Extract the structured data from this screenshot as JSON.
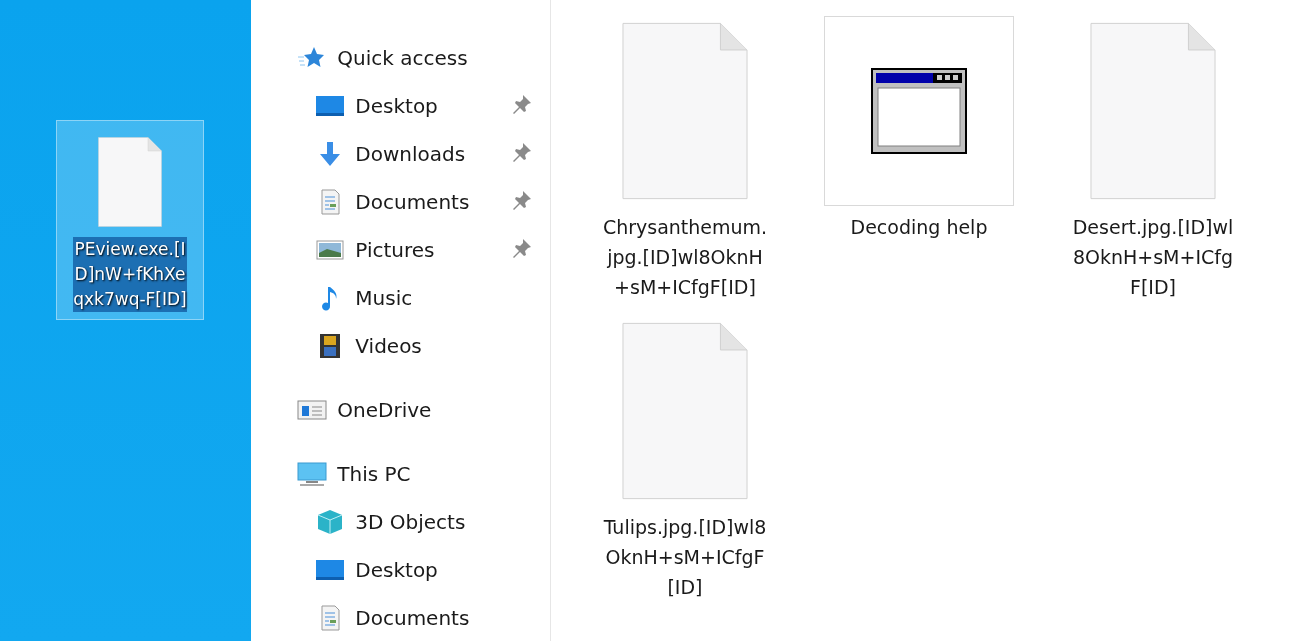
{
  "desktop": {
    "icons": [
      {
        "kind": "file",
        "lines": [
          "PEview.exe.[I",
          "D]nW+fKhXe",
          "qxk7wq-F[ID]"
        ],
        "selected": true
      }
    ]
  },
  "navigation": [
    {
      "label": "Quick access",
      "kind": "star",
      "children": [
        {
          "label": "Desktop",
          "kind": "desktop",
          "pinned": true
        },
        {
          "label": "Downloads",
          "kind": "download",
          "pinned": true
        },
        {
          "label": "Documents",
          "kind": "document",
          "pinned": true
        },
        {
          "label": "Pictures",
          "kind": "pictures",
          "pinned": true
        },
        {
          "label": "Music",
          "kind": "music",
          "pinned": false
        },
        {
          "label": "Videos",
          "kind": "videos",
          "pinned": false
        }
      ]
    },
    {
      "label": "OneDrive",
      "kind": "onedrive"
    },
    {
      "label": "This PC",
      "kind": "pc",
      "children": [
        {
          "label": "3D Objects",
          "kind": "cube",
          "pinned": false
        },
        {
          "label": "Desktop",
          "kind": "desktop",
          "pinned": false
        },
        {
          "label": "Documents",
          "kind": "document",
          "pinned": false
        }
      ]
    }
  ],
  "files": [
    {
      "kind": "file",
      "lines": [
        "Chrysanthemum.",
        "jpg.[ID]wl8OknH",
        "+sM+ICfgF[ID]"
      ],
      "selected": false
    },
    {
      "kind": "app",
      "lines": [
        "Decoding help"
      ],
      "selected": true
    },
    {
      "kind": "file",
      "lines": [
        "Desert.jpg.[ID]wl",
        "8OknH+sM+ICfg",
        "F[ID]"
      ],
      "selected": false
    },
    {
      "kind": "file",
      "lines": [
        "Tulips.jpg.[ID]wl8",
        "OknH+sM+ICfgF",
        "[ID]"
      ],
      "selected": false
    }
  ]
}
